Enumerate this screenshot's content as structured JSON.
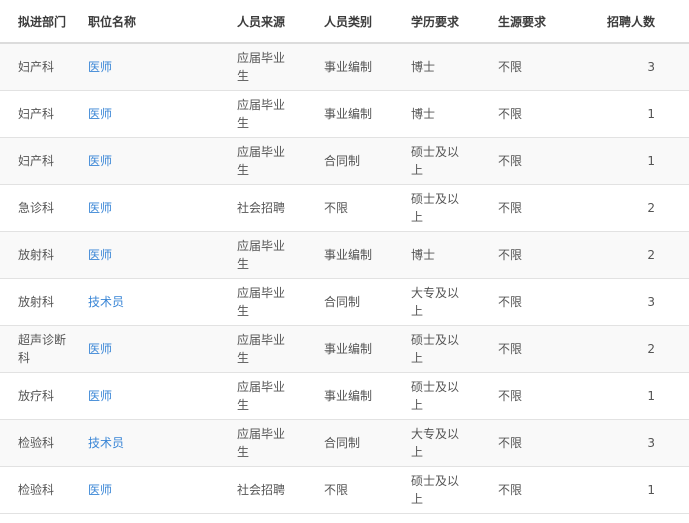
{
  "table": {
    "headers": {
      "dept": "拟进部门",
      "position": "职位名称",
      "source": "人员来源",
      "category": "人员类别",
      "education": "学历要求",
      "origin": "生源要求",
      "count": "招聘人数"
    },
    "rows": [
      {
        "dept": "妇产科",
        "position": "医师",
        "source": "应届毕业生",
        "category": "事业编制",
        "education": "博士",
        "origin": "不限",
        "count": "3"
      },
      {
        "dept": "妇产科",
        "position": "医师",
        "source": "应届毕业生",
        "category": "事业编制",
        "education": "博士",
        "origin": "不限",
        "count": "1"
      },
      {
        "dept": "妇产科",
        "position": "医师",
        "source": "应届毕业生",
        "category": "合同制",
        "education": "硕士及以上",
        "origin": "不限",
        "count": "1"
      },
      {
        "dept": "急诊科",
        "position": "医师",
        "source": "社会招聘",
        "category": "不限",
        "education": "硕士及以上",
        "origin": "不限",
        "count": "2"
      },
      {
        "dept": "放射科",
        "position": "医师",
        "source": "应届毕业生",
        "category": "事业编制",
        "education": "博士",
        "origin": "不限",
        "count": "2"
      },
      {
        "dept": "放射科",
        "position": "技术员",
        "source": "应届毕业生",
        "category": "合同制",
        "education": "大专及以上",
        "origin": "不限",
        "count": "3"
      },
      {
        "dept": "超声诊断科",
        "position": "医师",
        "source": "应届毕业生",
        "category": "事业编制",
        "education": "硕士及以上",
        "origin": "不限",
        "count": "2"
      },
      {
        "dept": "放疗科",
        "position": "医师",
        "source": "应届毕业生",
        "category": "事业编制",
        "education": "硕士及以上",
        "origin": "不限",
        "count": "1"
      },
      {
        "dept": "检验科",
        "position": "技术员",
        "source": "应届毕业生",
        "category": "合同制",
        "education": "大专及以上",
        "origin": "不限",
        "count": "3"
      },
      {
        "dept": "检验科",
        "position": "医师",
        "source": "社会招聘",
        "category": "不限",
        "education": "硕士及以上",
        "origin": "不限",
        "count": "1"
      }
    ]
  },
  "colors": {
    "link": "#3a86d6",
    "stripe": "#f9f9f9",
    "text": "#555555",
    "header_text": "#3c3c3c"
  }
}
